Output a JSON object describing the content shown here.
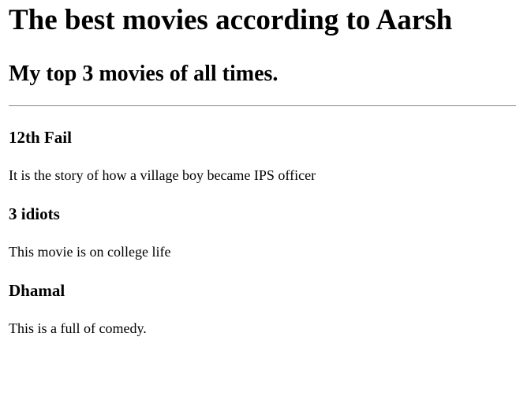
{
  "page": {
    "title": "The best movies according to Aarsh",
    "subtitle": "My top 3 movies of all times."
  },
  "movies": [
    {
      "title": "12th Fail",
      "description": "It is the story of how a village boy became IPS officer"
    },
    {
      "title": "3 idiots",
      "description": "This movie is on college life"
    },
    {
      "title": "Dhamal",
      "description": "This is a full of comedy."
    }
  ]
}
